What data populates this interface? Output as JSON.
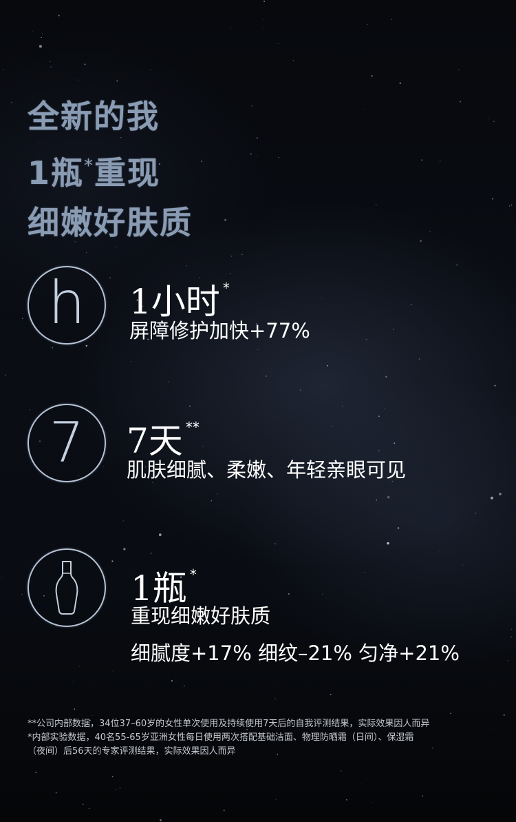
{
  "headline": {
    "line1": "全新的我",
    "line2_pre": "1瓶",
    "line2_mark": "*",
    "line2_post": "重现",
    "line3": "细嫩好肤质"
  },
  "benefits": [
    {
      "icon": "h-letter-icon",
      "icon_glyph": "h",
      "value": "1小时",
      "mark": "*",
      "lines": [
        "屏障修护加快+77%"
      ]
    },
    {
      "icon": "seven-numeral-icon",
      "icon_glyph": "7",
      "value": "7天",
      "mark": "**",
      "lines": [
        "肌肤细腻、柔嫩、年轻亲眼可见"
      ]
    },
    {
      "icon": "serum-bottle-icon",
      "value": "1瓶",
      "mark": "*",
      "lines": [
        "重现细嫩好肤质",
        "细腻度+17% 细纹–21% 匀净+21%"
      ]
    }
  ],
  "footnotes": [
    "**公司内部数据，34位37–60岁的女性单次使用及持续使用7天后的自我评测结果，实际效果因人而异",
    "*内部实验数据，40名55-65岁亚洲女性每日使用两次搭配基础洁面、物理防晒霜（日间）、保湿霜",
    "（夜间）后56天的专家评测结果，实际效果因人而异"
  ],
  "colors": {
    "background": "#06080d",
    "headline": "#8a9cb4",
    "ring": "#b6c3d6",
    "text": "#ffffff",
    "footnote": "#c4c8cf"
  }
}
